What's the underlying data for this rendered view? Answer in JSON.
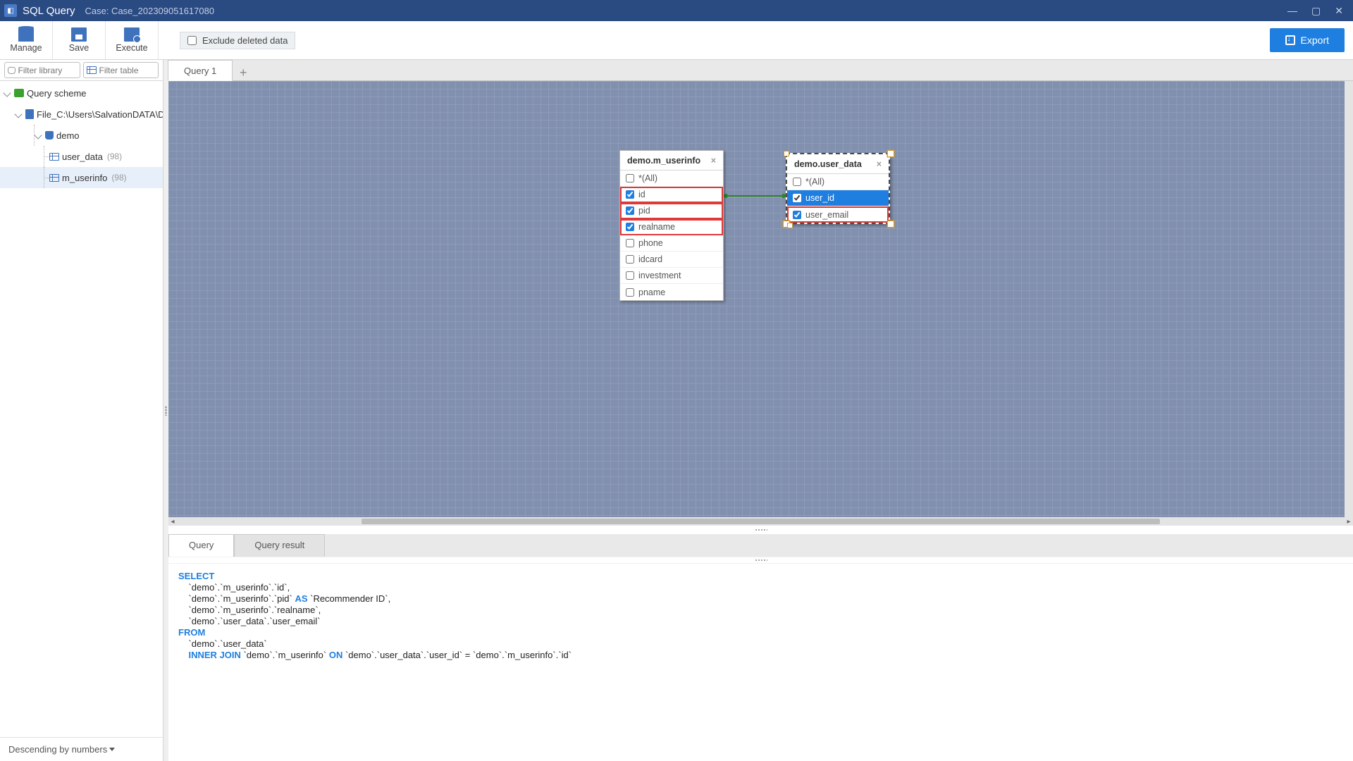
{
  "titlebar": {
    "app_name": "SQL Query",
    "case_text": "Case: Case_202309051617080"
  },
  "toolbar": {
    "manage": "Manage",
    "save": "Save",
    "execute": "Execute",
    "exclude_label": "Exclude deleted data",
    "export": "Export"
  },
  "sidebar": {
    "filter_library_placeholder": "Filter library",
    "filter_table_placeholder": "Filter table",
    "tree": {
      "scheme_label": "Query scheme",
      "file_label": "File_C:\\Users\\SalvationDATA\\De...",
      "db_label": "demo",
      "tables": [
        {
          "name": "user_data",
          "count": "(98)"
        },
        {
          "name": "m_userinfo",
          "count": "(98)"
        }
      ]
    },
    "footer_sort": "Descending by numbers"
  },
  "tabs": {
    "first": "Query 1"
  },
  "canvas": {
    "node1": {
      "title": "demo.m_userinfo",
      "rows": [
        {
          "label": "*(All)",
          "checked": false,
          "hl": false
        },
        {
          "label": "id",
          "checked": true,
          "hl": true
        },
        {
          "label": "pid",
          "checked": true,
          "hl": true
        },
        {
          "label": "realname",
          "checked": true,
          "hl": true
        },
        {
          "label": "phone",
          "checked": false,
          "hl": false
        },
        {
          "label": "idcard",
          "checked": false,
          "hl": false
        },
        {
          "label": "investment",
          "checked": false,
          "hl": false
        },
        {
          "label": "pname",
          "checked": false,
          "hl": false
        }
      ]
    },
    "node2": {
      "title": "demo.user_data",
      "rows": [
        {
          "label": "*(All)",
          "checked": false,
          "hl": false,
          "sel": false
        },
        {
          "label": "user_id",
          "checked": true,
          "hl": false,
          "sel": true
        },
        {
          "label": "user_email",
          "checked": true,
          "hl": true,
          "sel": false
        }
      ]
    }
  },
  "bottom_tabs": {
    "query": "Query",
    "result": "Query result"
  },
  "sql": {
    "kw_select": "SELECT",
    "line1": "    `demo`.`m_userinfo`.`id`,",
    "line2": "    `demo`.`m_userinfo`.`pid` ",
    "kw_as": "AS",
    "line2b": " `Recommender ID`,",
    "line3": "    `demo`.`m_userinfo`.`realname`,",
    "line4": "    `demo`.`user_data`.`user_email`",
    "kw_from": "FROM",
    "line5": "    `demo`.`user_data`",
    "line6a": "    ",
    "kw_join": "INNER JOIN",
    "line6b": " `demo`.`m_userinfo` ",
    "kw_on": "ON",
    "line6c": " `demo`.`user_data`.`user_id` = `demo`.`m_userinfo`.`id`"
  }
}
